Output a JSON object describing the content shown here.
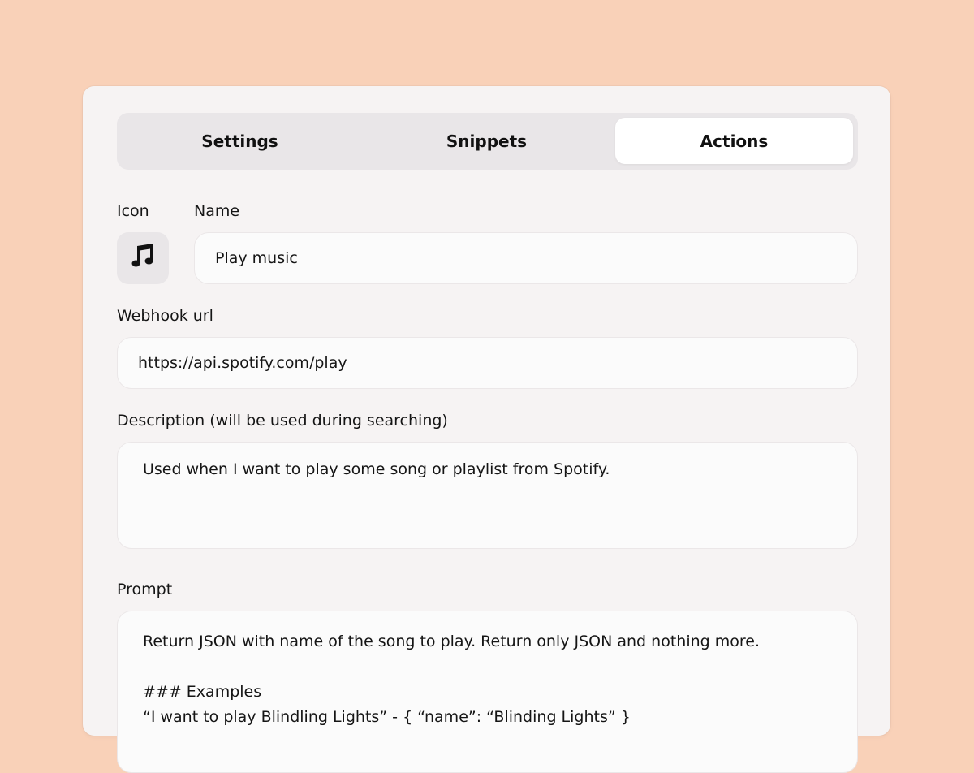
{
  "tabs": [
    {
      "label": "Settings",
      "active": false
    },
    {
      "label": "Snippets",
      "active": false
    },
    {
      "label": "Actions",
      "active": true
    }
  ],
  "form": {
    "icon_label": "Icon",
    "icon_name": "music-note-icon",
    "name_label": "Name",
    "name_value": "Play music",
    "webhook_label": "Webhook url",
    "webhook_value": "https://api.spotify.com/play",
    "description_label": "Description (will be used during searching)",
    "description_value": "Used when I want to play some song or playlist from Spotify.",
    "prompt_label": "Prompt",
    "prompt_value": "Return JSON with name of the song to play. Return only JSON and nothing more.\n\n### Examples\n“I want to play Blindling Lights” - { “name”: “Blinding Lights” }"
  },
  "colors": {
    "background": "#f9d1b8",
    "card": "#f6f3f3",
    "tab_bar": "#e9e6e8",
    "active_tab": "#ffffff",
    "field": "#fbfbfb"
  }
}
